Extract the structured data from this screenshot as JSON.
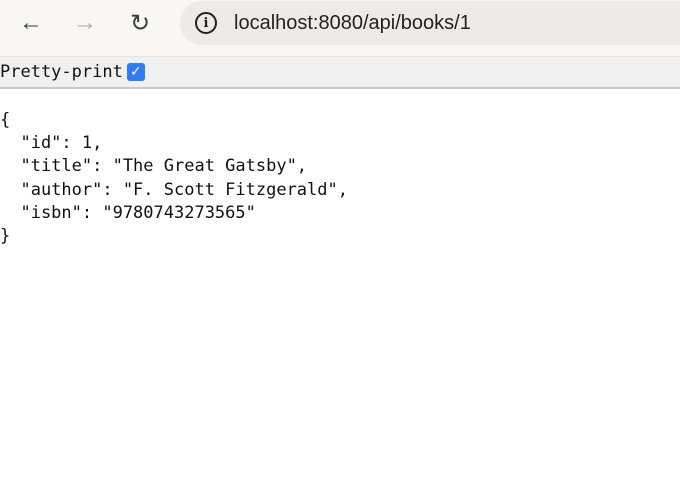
{
  "browser": {
    "back_icon": "arrow-left",
    "forward_icon": "arrow-right",
    "reload_icon": "reload",
    "url": "localhost:8080/api/books/1"
  },
  "viewer": {
    "pretty_print_label": "Pretty-print",
    "pretty_print_checked": true
  },
  "json_lines": [
    "{",
    "  \"id\": 1,",
    "  \"title\": \"The Great Gatsby\",",
    "  \"author\": \"F. Scott Fitzgerald\",",
    "  \"isbn\": \"9780743273565\"",
    "}"
  ]
}
